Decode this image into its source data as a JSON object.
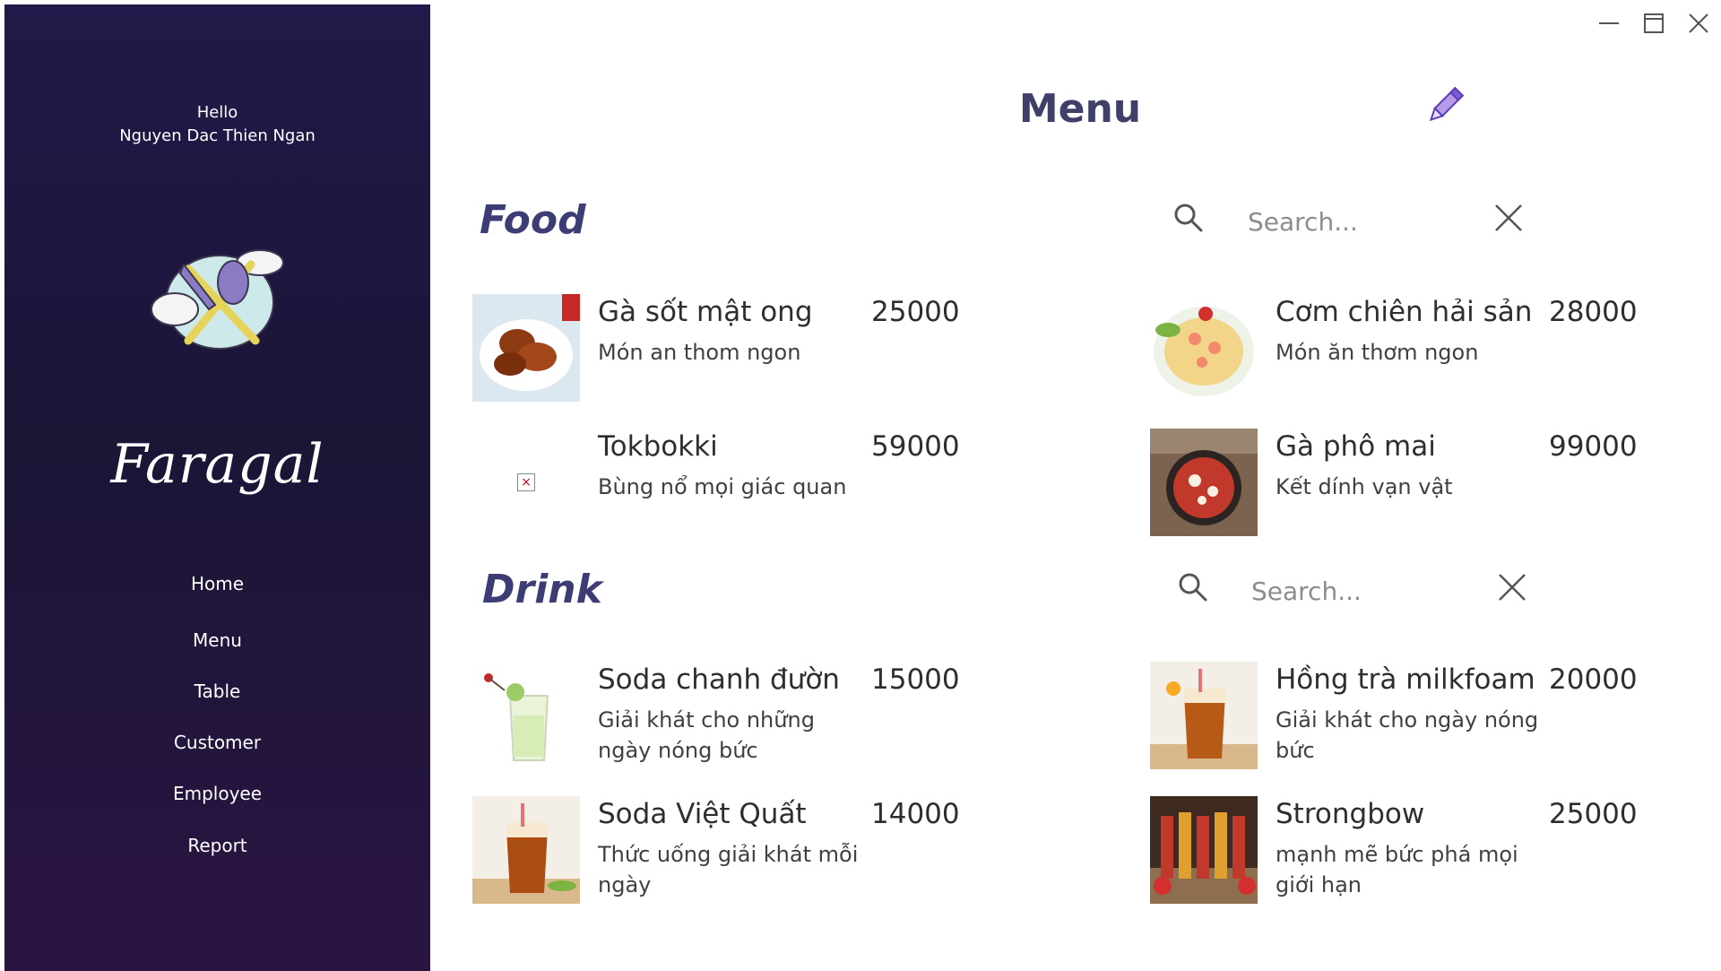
{
  "window": {
    "minimize_icon": "minimize-icon",
    "maximize_icon": "maximize-icon",
    "close_icon": "close-icon"
  },
  "sidebar": {
    "greeting": "Hello",
    "user_name": "Nguyen Dac Thien Ngan",
    "logo_icon": "spoon-knife-cloud-icon",
    "brand": "Faragal",
    "nav": [
      "Home",
      "Menu",
      "Table",
      "Customer",
      "Employee",
      "Report"
    ]
  },
  "main": {
    "title": "Menu",
    "edit_icon": "pencil-icon",
    "food": {
      "title": "Food",
      "search_placeholder": "Search...",
      "items": [
        {
          "name": "Gà sốt mật ong",
          "desc": "Món an thom ngon",
          "price": "25000"
        },
        {
          "name": "Cơm chiên hải sản",
          "desc": "Món ăn thơm ngon",
          "price": "28000"
        },
        {
          "name": "Tokbokki",
          "desc": "Bùng nổ mọi giác quan",
          "price": "59000"
        },
        {
          "name": "Gà phô mai",
          "desc": "Kết dính vạn vật",
          "price": "99000"
        }
      ]
    },
    "drink": {
      "title": "Drink",
      "search_placeholder": "Search...",
      "items": [
        {
          "name": "Soda  chanh đườn",
          "desc": "Giải khát cho những ngày nóng bức",
          "price": "15000"
        },
        {
          "name": "Hồng trà milkfoam",
          "desc": "Giải khát cho ngày nóng bức",
          "price": "20000"
        },
        {
          "name": "Soda Việt Quất",
          "desc": "Thức uống giải khát mỗi ngày",
          "price": "14000"
        },
        {
          "name": "Strongbow",
          "desc": "mạnh mẽ bức phá mọi giới hạn",
          "price": "25000"
        }
      ]
    }
  },
  "colors": {
    "sidebar_top": "#22194a",
    "sidebar_bottom": "#2a1542",
    "section_title": "#3b3d74",
    "title": "#3f3f6a"
  }
}
